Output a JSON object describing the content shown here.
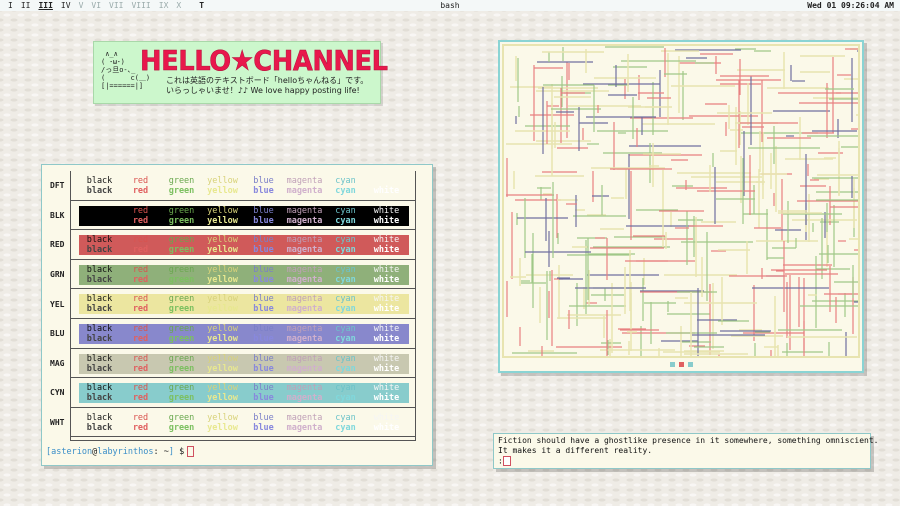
{
  "topbar": {
    "workspaces": [
      {
        "label": "I",
        "state": "normal"
      },
      {
        "label": "II",
        "state": "normal"
      },
      {
        "label": "III",
        "state": "active"
      },
      {
        "label": "IV",
        "state": "normal"
      },
      {
        "label": "V",
        "state": "dim"
      },
      {
        "label": "VI",
        "state": "dim"
      },
      {
        "label": "VII",
        "state": "dim"
      },
      {
        "label": "VIII",
        "state": "dim"
      },
      {
        "label": "IX",
        "state": "dim"
      },
      {
        "label": "X",
        "state": "dim"
      }
    ],
    "layout_symbol": "T",
    "window_title": "bash",
    "clock": "Wed 01 09:26:04 AM"
  },
  "banner": {
    "ascii_art": " ∧_∧\n( ･ω･)\n/っ旦o-､_\n(      c(＿)\n[|======|]",
    "title": "HELLO★CHANNEL",
    "line1": "これは英語のテキストボード「helloちゃんねる」です。",
    "line2": "いらっしゃいませ！♪♪ We love happy posting life!"
  },
  "terminal": {
    "row_labels": [
      "DFT",
      "BLK",
      "RED",
      "GRN",
      "YEL",
      "BLU",
      "MAG",
      "CYN",
      "WHT"
    ],
    "columns": [
      "black",
      "red",
      "green",
      "yellow",
      "blue",
      "magenta",
      "cyan",
      "white"
    ],
    "fg_colors": [
      "#111111",
      "#d9534f",
      "#6aa84f",
      "#d8d27a",
      "#7b7fc8",
      "#c0a0b8",
      "#6cc3c9",
      "#f5f5f5"
    ],
    "bold_colors": [
      "#444444",
      "#e06060",
      "#7cc060",
      "#e8e890",
      "#8888dd",
      "#d0b0cc",
      "#80d8dc",
      "#ffffff"
    ],
    "bg_colors": [
      "transparent",
      "#000000",
      "#d05a5a",
      "#8fb07a",
      "#ece6a0",
      "#8888cc",
      "#c8c8b0",
      "#88cccc",
      "#fbf9e9"
    ],
    "prompt": {
      "user": "asterion",
      "host": "labyrinthos",
      "path": "~",
      "symbol": "$"
    }
  },
  "maze": {
    "colors": [
      "#e88080",
      "#a0c888",
      "#7070a0",
      "#e8e4b0"
    ],
    "dots": [
      "#88cccc",
      "#e06060",
      "#88cccc"
    ]
  },
  "quote": {
    "line1": "Fiction should have a ghostlike presence in it somewhere, something omniscient.",
    "line2": "It makes it a different reality.",
    "line3": ":"
  }
}
